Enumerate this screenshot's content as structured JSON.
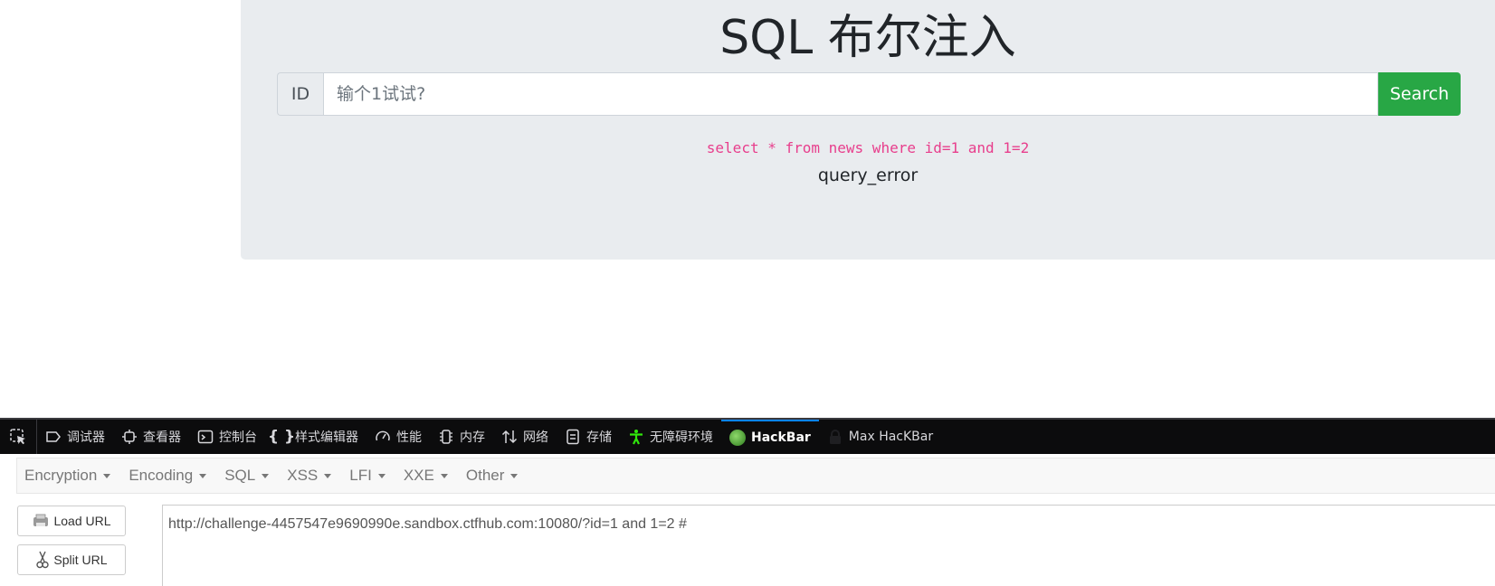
{
  "page": {
    "title": "SQL 布尔注入",
    "id_label": "ID",
    "input_placeholder": "输个1试试?",
    "input_value": "",
    "search_label": "Search",
    "sql_query": "select * from news where id=1 and 1=2",
    "result": "query_error"
  },
  "devtools": {
    "tabs": [
      {
        "label": "调试器",
        "icon": "debugger-icon"
      },
      {
        "label": "查看器",
        "icon": "inspector-icon"
      },
      {
        "label": "控制台",
        "icon": "console-icon"
      },
      {
        "label": "样式编辑器",
        "icon": "style-editor-icon"
      },
      {
        "label": "性能",
        "icon": "performance-icon"
      },
      {
        "label": "内存",
        "icon": "memory-icon"
      },
      {
        "label": "网络",
        "icon": "network-icon"
      },
      {
        "label": "存储",
        "icon": "storage-icon"
      },
      {
        "label": "无障碍环境",
        "icon": "accessibility-icon"
      },
      {
        "label": "HackBar",
        "icon": "hackbar-icon",
        "active": true
      },
      {
        "label": "Max HacKBar",
        "icon": "lock-icon"
      }
    ]
  },
  "hackbar": {
    "menu": [
      "Encryption",
      "Encoding",
      "SQL",
      "XSS",
      "LFI",
      "XXE",
      "Other"
    ],
    "load_url_label": "Load URL",
    "split_url_label": "Split URL",
    "url": "http://challenge-4457547e9690990e.sandbox.ctfhub.com:10080/?id=1 and 1=2 #"
  },
  "colors": {
    "jumbotron_bg": "#e9ecef",
    "search_button": "#28a745",
    "sql_text": "#e83e8c",
    "devtools_bg": "#0c0c0d",
    "active_tab_accent": "#0a84ff"
  }
}
